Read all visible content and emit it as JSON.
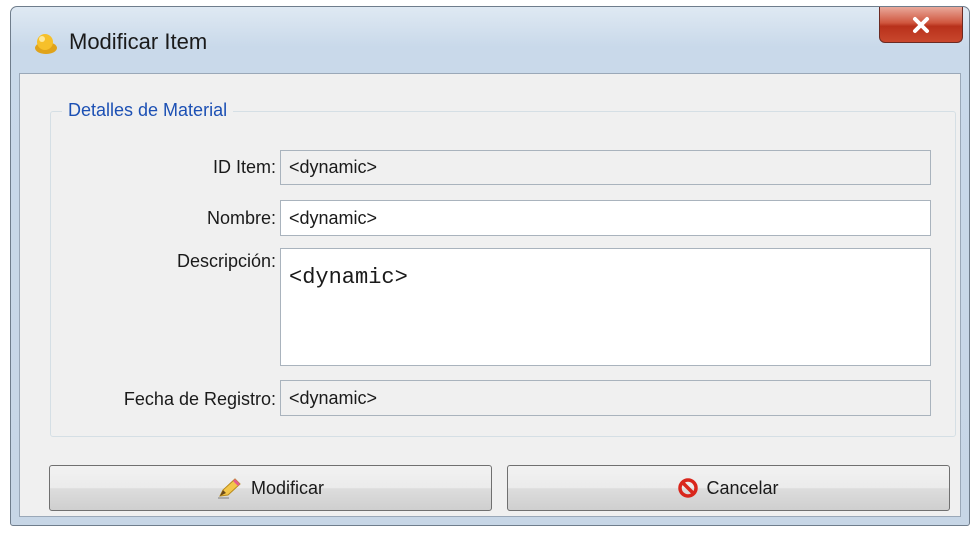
{
  "window": {
    "title": "Modificar Item",
    "icon": "app-icon",
    "close_icon": "close-icon"
  },
  "group": {
    "legend": "Detalles de Material"
  },
  "fields": {
    "id_item": {
      "label": "ID Item:",
      "value": "<dynamic>"
    },
    "nombre": {
      "label": "Nombre:",
      "value": "<dynamic>"
    },
    "descripcion": {
      "label": "Descripción:",
      "value": "<dynamic>"
    },
    "fecha_registro": {
      "label": "Fecha de Registro:",
      "value": "<dynamic>"
    }
  },
  "buttons": {
    "modificar": {
      "label": "Modificar",
      "icon": "pencil-icon"
    },
    "cancelar": {
      "label": "Cancelar",
      "icon": "cancel-icon"
    }
  },
  "colors": {
    "legend": "#1c50b4",
    "close_button": "#c9472d",
    "cancel_icon": "#d9261c"
  }
}
